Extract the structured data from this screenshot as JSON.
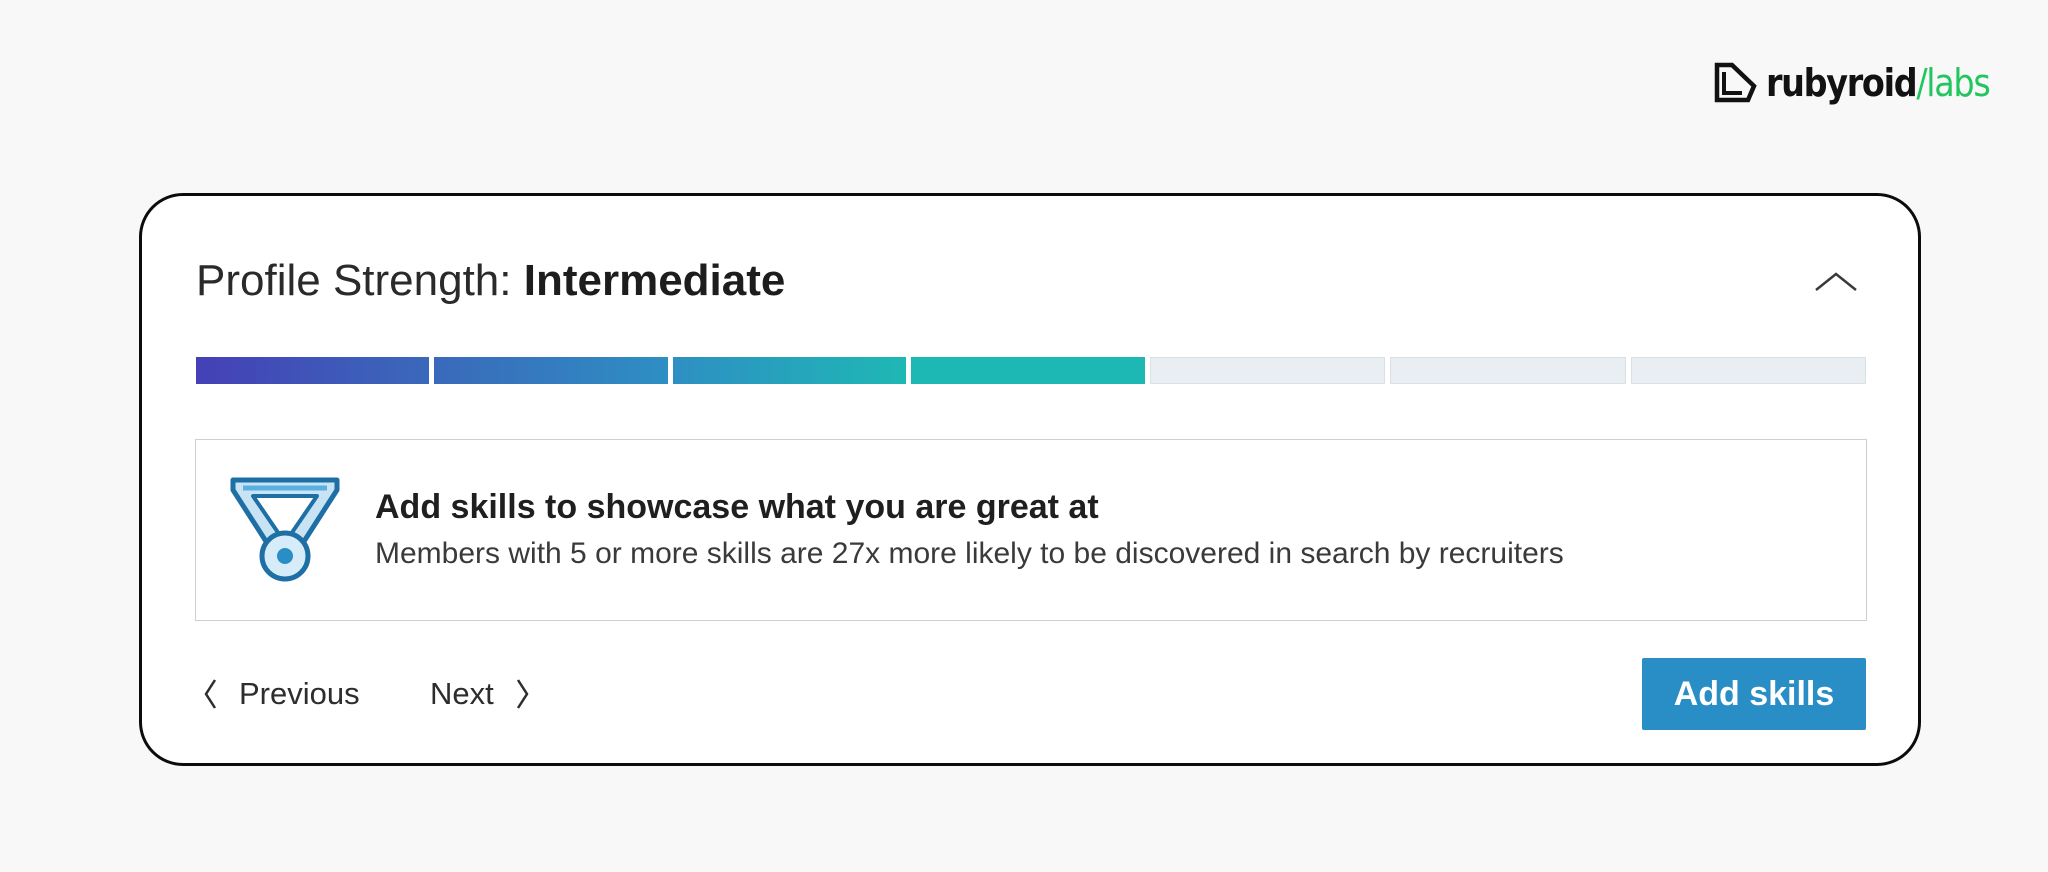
{
  "logo": {
    "word": "rubyroid",
    "accent": "/labs",
    "accent_color": "#22c55e"
  },
  "profile": {
    "title_prefix": "Profile Strength: ",
    "level": "Intermediate",
    "collapse_icon": "chevron-up-icon"
  },
  "progress": {
    "total_steps": 7,
    "completed_steps": 4,
    "segment_colors": [
      "#4540b6",
      "#3a69bb",
      "#2e8fc3",
      "#1eb8b4"
    ],
    "empty_color": "#e9eef2"
  },
  "suggestion": {
    "icon": "medal-icon",
    "title": "Add skills to showcase what you are great at",
    "description": "Members with 5 or more skills are 27x more likely to be discovered in search by recruiters"
  },
  "footer": {
    "previous_label": "Previous",
    "next_label": "Next",
    "primary_label": "Add skills",
    "primary_color": "#2a8ec6"
  }
}
